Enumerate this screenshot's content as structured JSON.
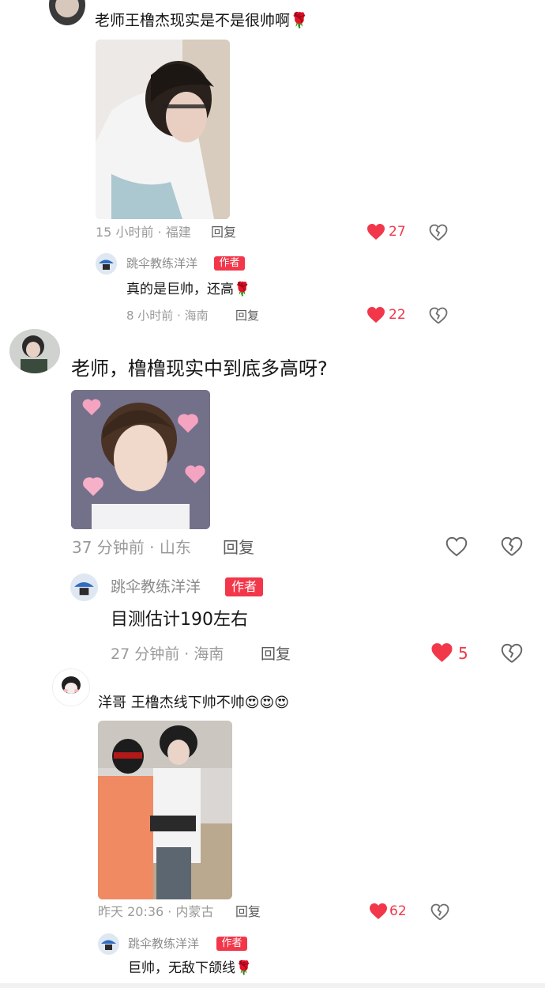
{
  "comments": [
    {
      "text": "老师王橹杰现实是不是很帅啊🌹",
      "meta": "15 小时前 · 福建",
      "reply_label": "回复",
      "like_count": "27",
      "liked": true,
      "replies": [
        {
          "author": "跳伞教练洋洋",
          "badge": "作者",
          "text": "真的是巨帅，还高🌹",
          "meta": "8 小时前 · 海南",
          "reply_label": "回复",
          "like_count": "22",
          "liked": true
        }
      ]
    },
    {
      "text": "老师，橹橹现实中到底多高呀?",
      "meta": "37 分钟前 · 山东",
      "reply_label": "回复",
      "like_count": "",
      "liked": false,
      "replies": [
        {
          "author": "跳伞教练洋洋",
          "badge": "作者",
          "text": "目测估计190左右",
          "meta": "27 分钟前 · 海南",
          "reply_label": "回复",
          "like_count": "5",
          "liked": true
        }
      ]
    },
    {
      "text": "洋哥 王橹杰线下帅不帅😍😍😍",
      "meta": "昨天 20:36 · 内蒙古",
      "reply_label": "回复",
      "like_count": "62",
      "liked": true,
      "replies": [
        {
          "author": "跳伞教练洋洋",
          "badge": "作者",
          "text": "巨帅，无敌下颌线🌹"
        }
      ]
    }
  ],
  "colors": {
    "like_red": "#f2374a",
    "meta_gray": "#9a9a9a"
  },
  "icons": {
    "like": "heart-icon",
    "dislike": "broken-heart-icon"
  }
}
